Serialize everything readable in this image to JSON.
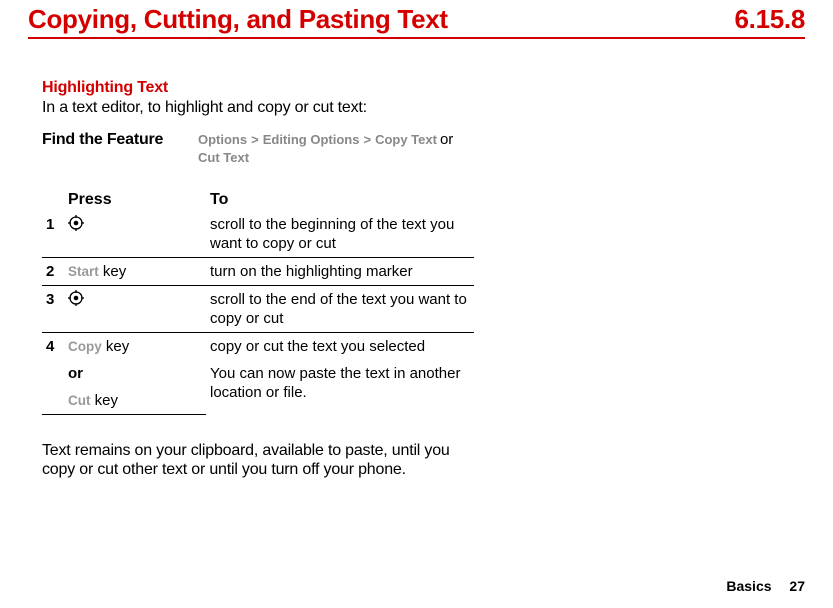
{
  "header": {
    "title": "Copying, Cutting, and Pasting Text",
    "version": "6.15.8"
  },
  "section": {
    "subhead": "Highlighting Text",
    "intro": "In a text editor, to highlight and copy or cut text:"
  },
  "feature": {
    "label": "Find the Feature",
    "options": "Options",
    "editing": "Editing Options",
    "copytext": "Copy Text",
    "or": "or",
    "cuttext": "Cut Text"
  },
  "table": {
    "head_press": "Press",
    "head_to": "To",
    "rows": [
      {
        "num": "1",
        "press_type": "nav",
        "to": "scroll to the beginning of the text you want to copy or cut"
      },
      {
        "num": "2",
        "press_key": "Start",
        "press_suffix": " key",
        "to": "turn on the highlighting marker"
      },
      {
        "num": "3",
        "press_type": "nav",
        "to": "scroll to the end of the text you want to copy or cut"
      },
      {
        "num": "4",
        "press_key": "Copy",
        "press_suffix": " key",
        "to": "copy or cut the text you selected"
      }
    ],
    "or_label": "or",
    "cut_key": "Cut",
    "cut_suffix": " key",
    "paste_note": "You can now paste the text in another location or file."
  },
  "outro": "Text remains on your clipboard, available to paste, until you copy or cut other text or until you turn off your phone.",
  "footer": {
    "section": "Basics",
    "page": "27"
  }
}
